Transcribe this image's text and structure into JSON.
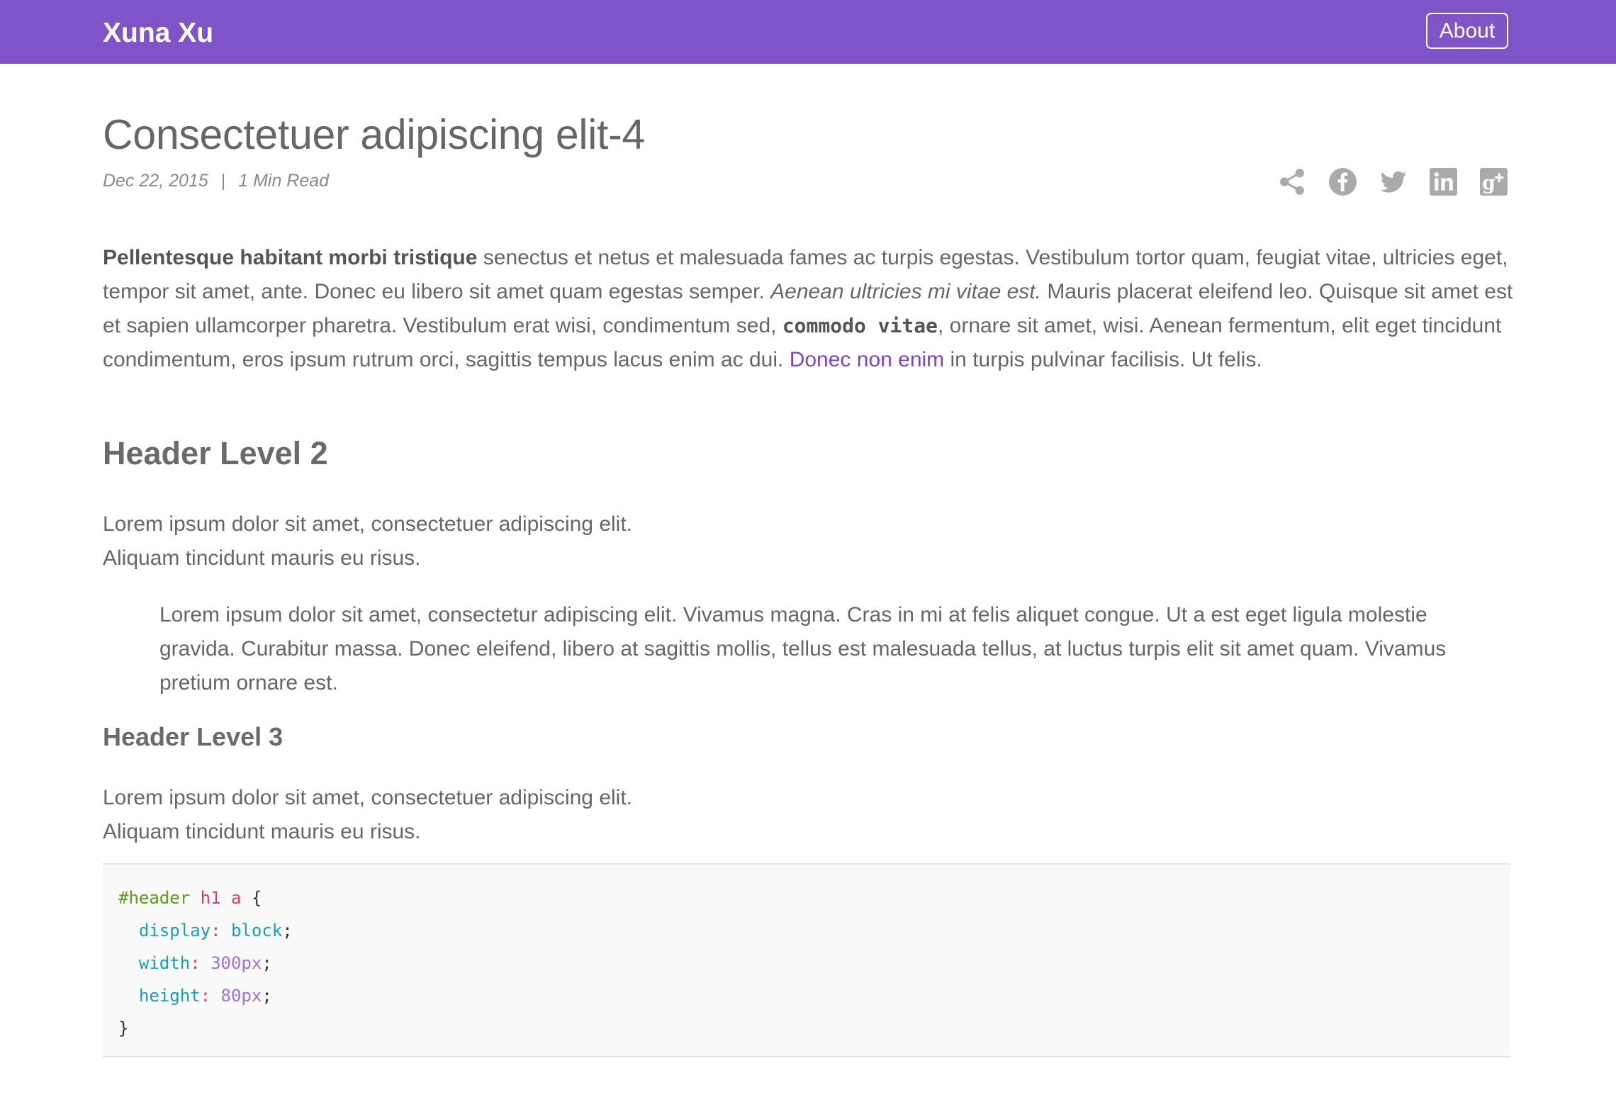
{
  "navbar": {
    "brand": "Xuna Xu",
    "about_label": "About",
    "bg_color": "#7f54c8"
  },
  "post": {
    "title": "Consectetuer adipiscing elit-4",
    "date": "Dec 22, 2015",
    "separator": "|",
    "read_time": "1 Min Read"
  },
  "share_icons": [
    "share-icon",
    "facebook-icon",
    "twitter-icon",
    "linkedin-icon",
    "google-plus-icon"
  ],
  "paragraph1": {
    "bold": "Pellentesque habitant morbi tristique",
    "text1": " senectus et netus et malesuada fames ac turpis egestas. Vestibulum tortor quam, feugiat vitae, ultricies eget, tempor sit amet, ante. Donec eu libero sit amet quam egestas semper. ",
    "italic": "Aenean ultricies mi vitae est.",
    "text2": " Mauris placerat eleifend leo. Quisque sit amet est et sapien ullamcorper pharetra. Vestibulum erat wisi, condimentum sed, ",
    "code": "commodo vitae",
    "text3": ", ornare sit amet, wisi. Aenean fermentum, elit eget tincidunt condimentum, eros ipsum rutrum orci, sagittis tempus lacus enim ac dui. ",
    "link": "Donec non enim",
    "text4": " in turpis pulvinar facilisis. Ut felis."
  },
  "header2": "Header Level 2",
  "lorem2": {
    "line1": "Lorem ipsum dolor sit amet, consectetuer adipiscing elit.",
    "line2": "Aliquam tincidunt mauris eu risus."
  },
  "blockquote": "Lorem ipsum dolor sit amet, consectetur adipiscing elit. Vivamus magna. Cras in mi at felis aliquet congue. Ut a est eget ligula molestie gravida. Curabitur massa. Donec eleifend, libero at sagittis mollis, tellus est malesuada tellus, at luctus turpis elit sit amet quam. Vivamus pretium ornare est.",
  "header3": "Header Level 3",
  "lorem3": {
    "line1": "Lorem ipsum dolor sit amet, consectetuer adipiscing elit.",
    "line2": "Aliquam tincidunt mauris eu risus."
  },
  "code": {
    "selector_id": "#header",
    "selector_tag1": "h1",
    "selector_tag2": "a",
    "open_brace": "{",
    "prop1": "display",
    "val1": "block",
    "prop2": "width",
    "val2": "300px",
    "prop3": "height",
    "val3": "80px",
    "close_brace": "}"
  }
}
